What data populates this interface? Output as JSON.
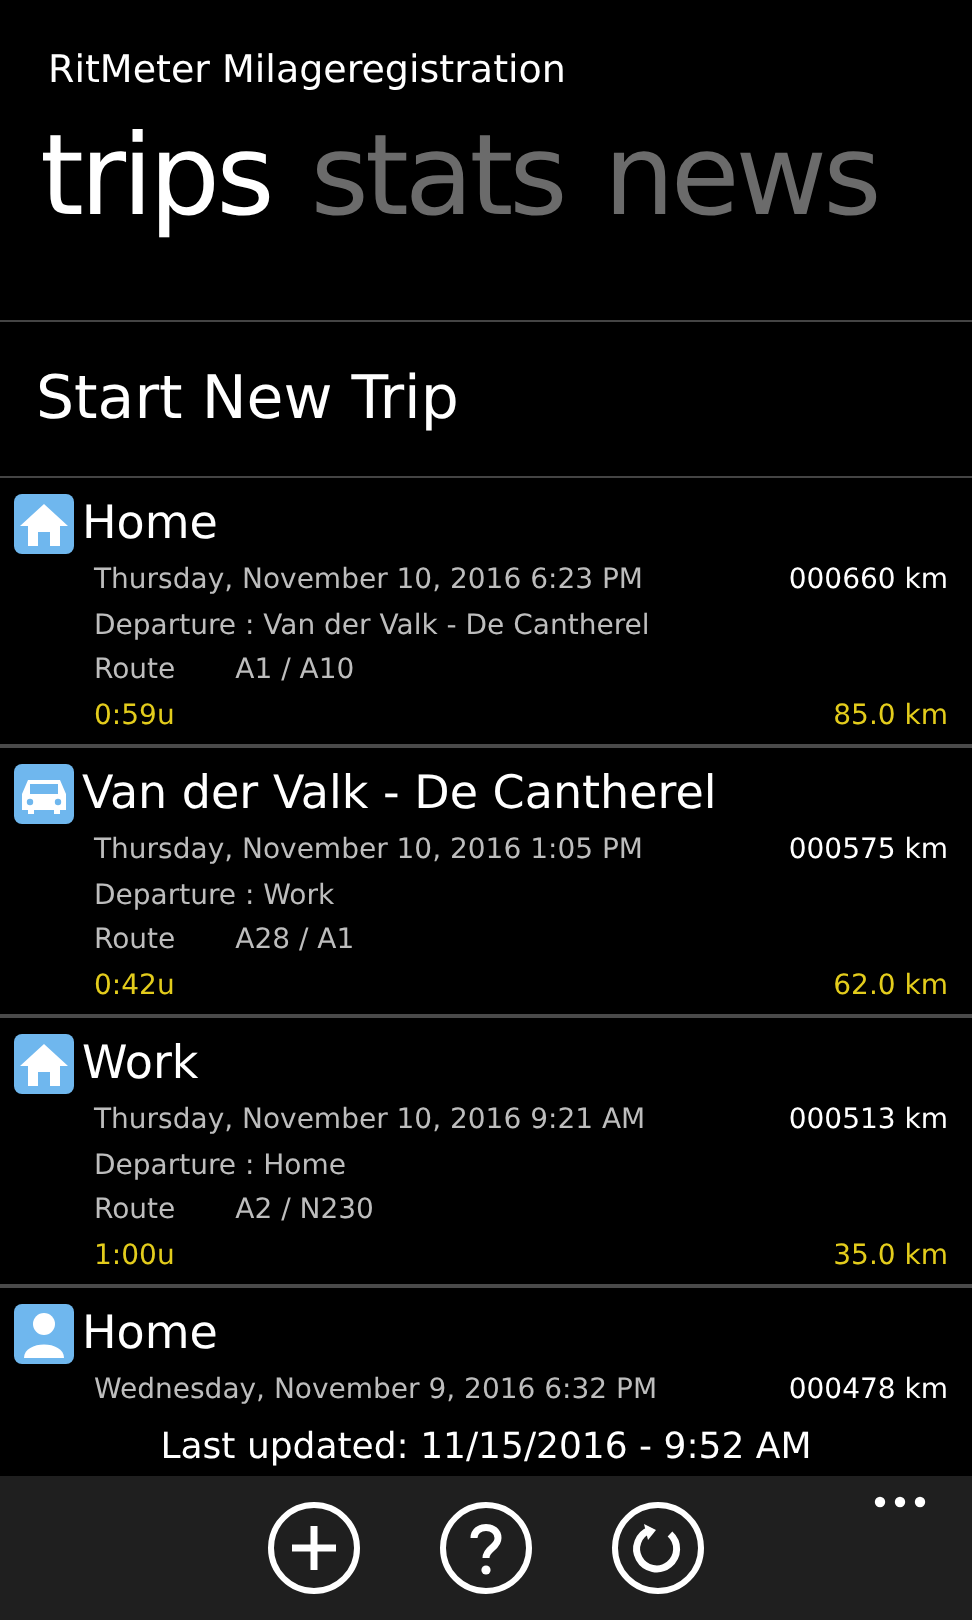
{
  "app_title": "RitMeter Milageregistration",
  "pivot": [
    {
      "label": "trips",
      "selected": true
    },
    {
      "label": "stats",
      "selected": false
    },
    {
      "label": "news",
      "selected": false
    }
  ],
  "start_button": "Start New Trip",
  "trips": [
    {
      "kind": "home",
      "title": "Home",
      "date": "Thursday, November 10, 2016 6:23 PM",
      "odometer": "000660 km",
      "departure": "Departure : Van der Valk - De Cantherel",
      "route_label": "Route",
      "route": "A1 / A10",
      "duration": "0:59u",
      "distance": "85.0 km"
    },
    {
      "kind": "car",
      "title": "Van der Valk - De Cantherel",
      "date": "Thursday, November 10, 2016 1:05 PM",
      "odometer": "000575 km",
      "departure": "Departure : Work",
      "route_label": "Route",
      "route": "A28 / A1",
      "duration": "0:42u",
      "distance": "62.0 km"
    },
    {
      "kind": "home",
      "title": "Work",
      "date": "Thursday, November 10, 2016 9:21 AM",
      "odometer": "000513 km",
      "departure": "Departure : Home",
      "route_label": "Route",
      "route": "A2 / N230",
      "duration": "1:00u",
      "distance": "35.0 km"
    },
    {
      "kind": "person",
      "title": "Home",
      "date": "Wednesday, November 9, 2016 6:32 PM",
      "odometer": "000478 km"
    }
  ],
  "status": "Last updated: 11/15/2016 - 9:52 AM",
  "app_bar": {
    "buttons": [
      {
        "kind": "add"
      },
      {
        "kind": "help"
      },
      {
        "kind": "refresh"
      }
    ]
  }
}
